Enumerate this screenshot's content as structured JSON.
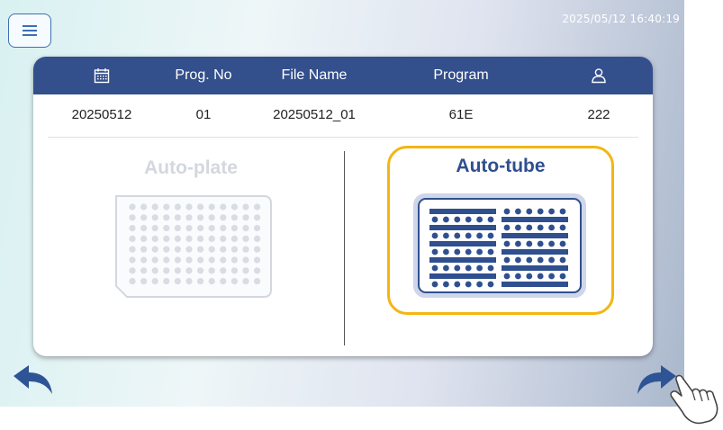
{
  "header": {
    "datetime": "2025/05/12  16:40:19"
  },
  "table": {
    "columns": [
      {
        "key": "date",
        "icon": "calendar-icon",
        "label": ""
      },
      {
        "key": "prog_no",
        "label": "Prog. No"
      },
      {
        "key": "file_name",
        "label": "File Name"
      },
      {
        "key": "program",
        "label": "Program"
      },
      {
        "key": "user",
        "icon": "user-icon",
        "label": ""
      }
    ],
    "row": {
      "date": "20250512",
      "prog_no": "01",
      "file_name": "20250512_01",
      "program": "61E",
      "user": "222"
    }
  },
  "options": {
    "plate": {
      "label": "Auto-plate",
      "state": "disabled"
    },
    "tube": {
      "label": "Auto-tube",
      "state": "selected"
    }
  },
  "nav": {
    "back_icon": "back-arrow-icon",
    "forward_icon": "forward-arrow-icon"
  },
  "colors": {
    "header_bg": "#334f8c",
    "accent": "#2f4f8f",
    "selection": "#f3b612",
    "disabled": "#d3d7de"
  }
}
